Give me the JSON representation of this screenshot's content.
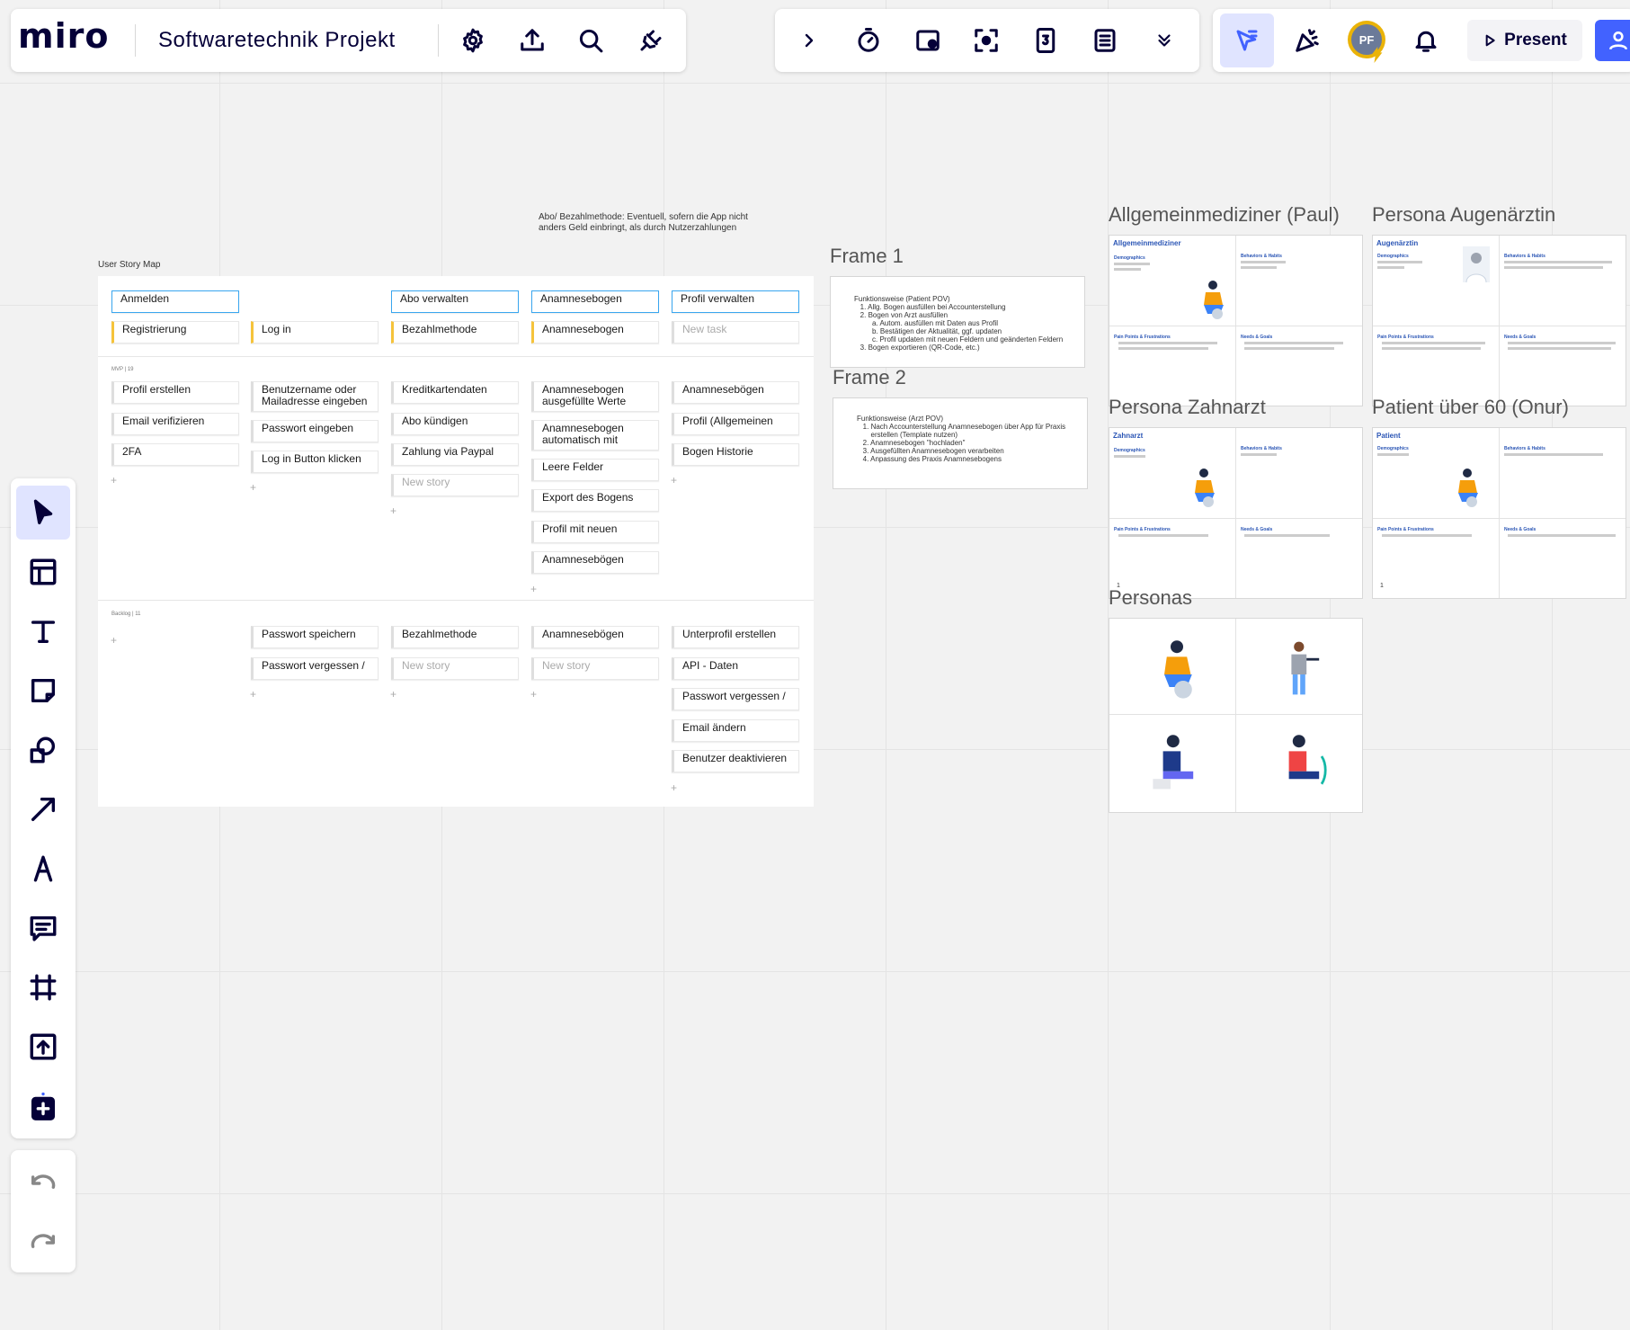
{
  "topbar": {
    "logo": "miro",
    "board_title": "Softwaretechnik Projekt",
    "present_label": "Present",
    "avatar_initials": "PF"
  },
  "board": {
    "note_text": "Abo/ Bezahlmethode: Eventuell, sofern die App nicht anders Geld einbringt, als durch Nutzerzahlungen",
    "storymap_title": "User Story Map",
    "mvp_label": "MVP",
    "mvp_count": "19",
    "backlog_label": "Backlog",
    "backlog_count": "11",
    "activities": [
      "Anmelden",
      "Abo verwalten",
      "Anamnesebogen",
      "Profil verwalten"
    ],
    "steps": [
      "Registrierung",
      "Log in",
      "Bezahlmethode",
      "Anamnesebogen",
      "New task"
    ],
    "mvp_columns": [
      [
        "Profil erstellen",
        "Email verifizieren",
        "2FA"
      ],
      [
        "Benutzername oder Mailadresse eingeben",
        "Passwort eingeben",
        "Log in Button klicken"
      ],
      [
        "Kreditkartendaten",
        "Abo kündigen",
        "Zahlung via Paypal",
        "New story"
      ],
      [
        "Anamnesebogen ausgefüllte Werte",
        "Anamnesebogen automatisch mit",
        "Leere Felder",
        "Export des Bogens",
        "Profil mit neuen",
        "Anamnesebögen"
      ],
      [
        "Anamnesebögen",
        "Profil (Allgemeinen",
        "Bogen Historie"
      ]
    ],
    "backlog_columns": [
      [],
      [
        "Passwort speichern",
        "Passwort vergessen /"
      ],
      [
        "Bezahlmethode",
        "New story"
      ],
      [
        "Anamnesebögen",
        "New story"
      ],
      [
        "Unterprofil erstellen",
        "API - Daten",
        "Passwort vergessen /",
        "Email ändern",
        "Benutzer deaktivieren"
      ]
    ],
    "plus": "+"
  },
  "frames": {
    "frame1_title": "Frame 1",
    "frame1_text": "Funktionsweise (Patient POV)\n   1. Allg. Bogen ausfüllen bei Accounterstellung\n   2. Bogen von Arzt ausfüllen\n         a. Autom. ausfüllen mit Daten aus Profil\n         b. Bestätigen der Aktualität, ggf. updaten\n         c. Profil updaten mit neuen Feldern und geänderten Feldern\n   3. Bogen exportieren (QR-Code, etc.)",
    "frame2_title": "Frame 2",
    "frame2_text": "Funktionsweise (Arzt POV)\n   1. Nach Accounterstellung Anamnesebogen über App für Praxis\n       erstellen (Template nutzen)\n   2. Anamnesebogen \"hochladen\"\n   3. Ausgefüllten Anamnesebogen verarbeiten\n   4. Anpassung des Praxis Anamnesebogens"
  },
  "personas": {
    "p1_title": "Allgemeinmediziner (Paul)",
    "p1_card": "Allgemeinmediziner",
    "p2_title": "Persona Augenärztin",
    "p2_card": "Augenärztin",
    "p3_title": "Persona Zahnarzt",
    "p3_card": "Zahnarzt",
    "p4_title": "Patient über 60 (Onur)",
    "p4_card": "Patient",
    "p5_title": "Personas",
    "demographics": "Demographics",
    "behaviors": "Behaviors & Habits",
    "pain_points": "Pain Points & Frustrations",
    "needs": "Needs & Goals",
    "page_num": "1"
  },
  "colors": {
    "accent": "#4262ff",
    "card_blue": "#39a6ef",
    "card_yellow": "#f5c33b"
  }
}
